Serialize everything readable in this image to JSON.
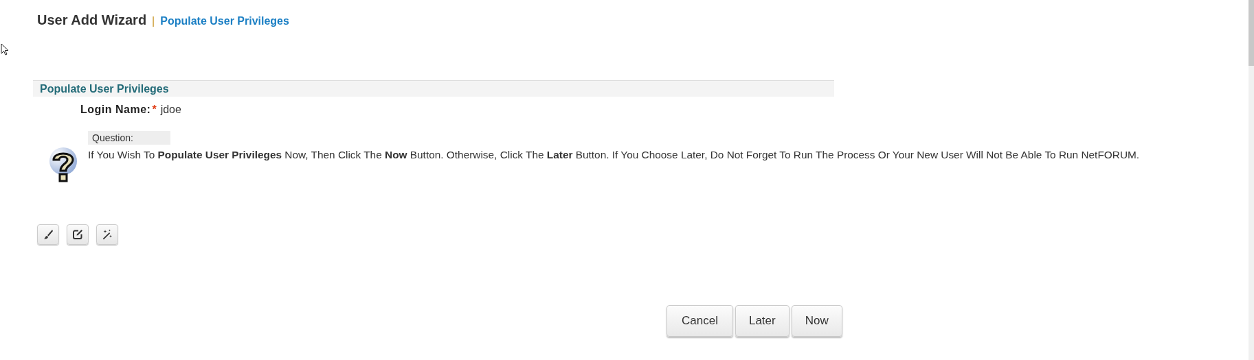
{
  "header": {
    "title": "User Add Wizard",
    "separator": "|",
    "step": "Populate User Privileges"
  },
  "section": {
    "title": "Populate User Privileges",
    "fields": [
      {
        "label": "Login Name:",
        "required": true,
        "required_mark": "*",
        "value": "jdoe"
      }
    ]
  },
  "question": {
    "label": "Question:",
    "text": "If You Wish To **Populate User Privileges** Now, Then Click The **Now** Button. Otherwise, Click The **Later** Button. If You Choose Later, Do Not Forget To Run The Process Or Your New User Will Not Be Able To Run NetFORUM."
  },
  "tools": [
    {
      "kind": "brush"
    },
    {
      "kind": "edit"
    },
    {
      "kind": "wand"
    }
  ],
  "buttons": [
    "Cancel",
    "Later",
    "Now"
  ]
}
